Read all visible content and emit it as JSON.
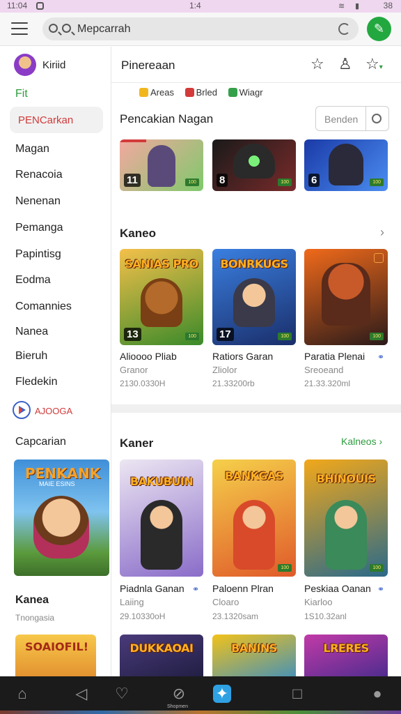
{
  "status_bar": {
    "time": "11:04",
    "center": "1:4",
    "battery": "38"
  },
  "search": {
    "value": "Mepcarrah"
  },
  "sidebar": {
    "profile_name": "Kiriid",
    "first_item": "Fit",
    "active_item": "PENCarkan",
    "items": [
      "Magan",
      "Renacoia",
      "Nenenan",
      "Pemanga",
      "Papintisg",
      "Eodma",
      "Comannies",
      "Nanea",
      "Bieruh",
      "Fledekin"
    ],
    "play_label": "AJOOGA",
    "capcarian": "Capcarian",
    "banner_title": "PENKANK",
    "banner_sub": "MAIE ESINS",
    "section_title": "Kanea",
    "section_sub": "Tnongasia",
    "bottom_thumb_title": "SOAIOFIL!"
  },
  "main": {
    "title": "Pinereaan",
    "filters": [
      {
        "label": "Areas",
        "color": "#f2b61d"
      },
      {
        "label": "Brled",
        "color": "#d33a3a"
      },
      {
        "label": "Wiagr",
        "color": "#35a04a"
      }
    ],
    "section1_title": "Pencakian Nagan",
    "sort_placeholder": "Benden",
    "top_row": [
      {
        "badge": "11",
        "colors": [
          "#f3a8a0",
          "#7fc96b"
        ]
      },
      {
        "badge": "8",
        "colors": [
          "#1a1a1a",
          "#7a2a2a"
        ]
      },
      {
        "badge": "6",
        "colors": [
          "#1a3aa8",
          "#4b8df0"
        ]
      }
    ],
    "section2_title": "Kaneo",
    "row2": [
      {
        "logo": "SANIAS PRO",
        "badge": "13",
        "title": "Alioooo Pliab",
        "sub": "Granor",
        "meta": "2130.0330H",
        "colors": [
          "#f4c04a",
          "#3a8a2a"
        ]
      },
      {
        "logo": "BONRKUGS",
        "badge": "17",
        "title": "Ratiors Garan",
        "sub": "Zliolor",
        "meta": "21.33200rb",
        "colors": [
          "#3a7fe0",
          "#1a2e6a"
        ]
      },
      {
        "logo": "",
        "badge": "",
        "title": "Paratia Plenai",
        "sub": "Sreoeand",
        "meta": "21.33.320ml",
        "colors": [
          "#f06a1a",
          "#2a1a1a"
        ]
      }
    ],
    "section3_title": "Kaner",
    "see_all": "Kalneos",
    "row3": [
      {
        "logo": "BAKUBUIN",
        "title": "Piadnla Ganan",
        "sub": "Laiing",
        "meta": "29.10330oH",
        "colors": [
          "#ece6f2",
          "#8a6cc9"
        ]
      },
      {
        "logo": "BANKGAS",
        "title": "Paloenn Plran",
        "sub": "Cloaro",
        "meta": "23.1320sam",
        "colors": [
          "#f5d04a",
          "#e05a2a"
        ]
      },
      {
        "logo": "BHINOUIS",
        "title": "Peskiaa Oanan",
        "sub": "Kiarloo",
        "meta": "1S10.32anl",
        "colors": [
          "#f2a81a",
          "#2a6a8a"
        ]
      }
    ],
    "row4": [
      {
        "logo": "DUKKAOAI",
        "colors": [
          "#4a3a7a",
          "#1a1a3a"
        ]
      },
      {
        "logo": "BANINS",
        "colors": [
          "#f2c21a",
          "#2a8ad0"
        ]
      },
      {
        "logo": "LRERES",
        "colors": [
          "#c23aa8",
          "#3a2a8a"
        ]
      }
    ]
  },
  "bottom_nav": {
    "items": [
      "home-icon",
      "back-icon",
      "chat-icon",
      "compass-icon",
      "tool-icon",
      "square-icon",
      "profile-icon"
    ],
    "compass_label": "Shopmen"
  }
}
